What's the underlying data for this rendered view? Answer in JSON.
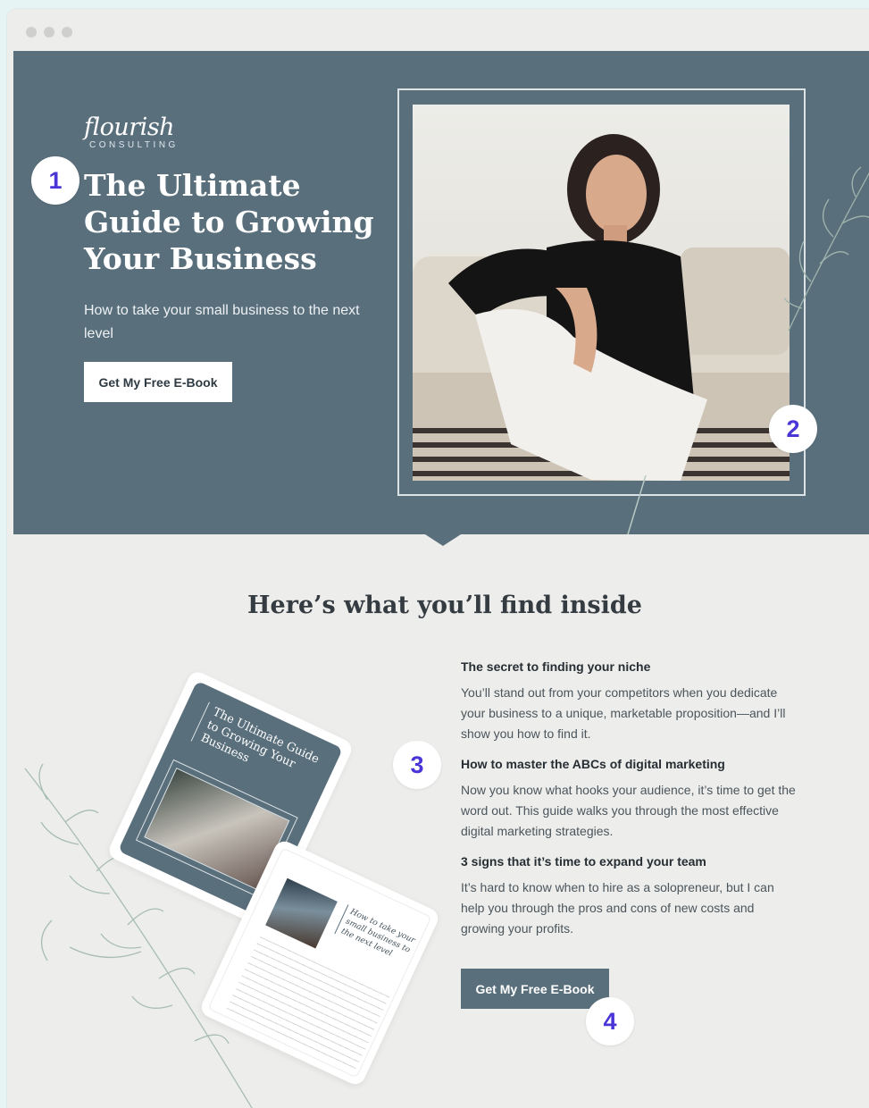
{
  "brand": {
    "logo_word": "flourish",
    "logo_sub": "CONSULTING"
  },
  "hero": {
    "title": "The Ultimate Guide to Growing Your Business",
    "subtitle": "How to take your small business to the next level",
    "cta_label": "Get My Free E-Book"
  },
  "inside": {
    "title": "Here’s what you’ll find inside",
    "items": [
      {
        "heading": "The secret to finding your niche",
        "body": "You’ll stand out from your competitors when you dedicate your business to a unique, marketable proposition—and I’ll show you how to find it."
      },
      {
        "heading": "How to master the ABCs of digital marketing",
        "body": "Now you know what hooks your audience, it’s time to get the word out. This guide walks you through the most effective digital marketing strategies."
      },
      {
        "heading": "3 signs that it’s time to expand your team",
        "body": "It’s hard to know when to hire as a solopreneur, but I can help you through the pros and cons of new costs and growing your profits."
      }
    ],
    "cta_label": "Get My Free E-Book"
  },
  "ebook_mockups": {
    "cover_title": "The Ultimate Guide to Growing Your Business",
    "page_text": "How to take your small business to the next level"
  },
  "annotations": [
    "1",
    "2",
    "3",
    "4"
  ],
  "colors": {
    "hero_bg": "#5a6f7c",
    "page_bg": "#ededeb",
    "badge_text": "#4a35d6"
  }
}
